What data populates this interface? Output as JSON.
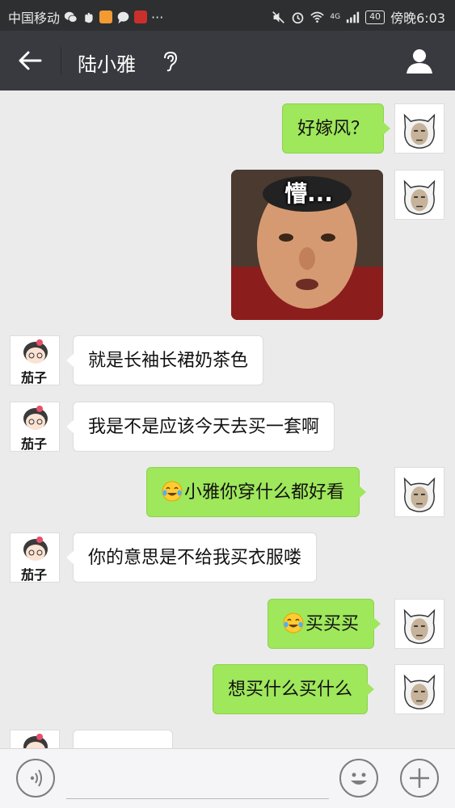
{
  "status_bar": {
    "carrier": "中国移动",
    "app_icons": [
      "wechat-icon",
      "gesture-icon",
      "weibo-icon",
      "chat-icon",
      "huawei-icon"
    ],
    "more": "···",
    "network": "4G",
    "battery": "40",
    "time": "傍晚6:03"
  },
  "nav": {
    "title": "陆小雅",
    "back_icon": "back-arrow-icon",
    "ear_icon": "ear-icon",
    "profile_icon": "profile-icon"
  },
  "avatars": {
    "other_label": "茄子"
  },
  "messages": [
    {
      "from": "me",
      "text": "好嫁风？"
    },
    {
      "from": "me",
      "type": "sticker",
      "caption": "懵..."
    },
    {
      "from": "other",
      "text": "就是长袖长裙奶茶色"
    },
    {
      "from": "other",
      "text": "我是不是应该今天去买一套啊"
    },
    {
      "from": "me",
      "emoji": "crying-laughing-emoji",
      "text": "小雅你穿什么都好看"
    },
    {
      "from": "other",
      "text": "你的意思是不给我买衣服喽"
    },
    {
      "from": "me",
      "emoji": "crying-laughing-emoji",
      "text": "买买买"
    },
    {
      "from": "me",
      "text": "想买什么买什么"
    }
  ],
  "input_bar": {
    "voice_icon": "voice-icon",
    "emoji_icon": "emoji-icon",
    "plus_icon": "plus-icon",
    "placeholder": ""
  },
  "colors": {
    "status_bar": "#2e2f31",
    "nav_bar": "#393a3f",
    "chat_background": "#ebebeb",
    "my_bubble": "#9fe75b",
    "other_bubble": "#ffffff"
  }
}
